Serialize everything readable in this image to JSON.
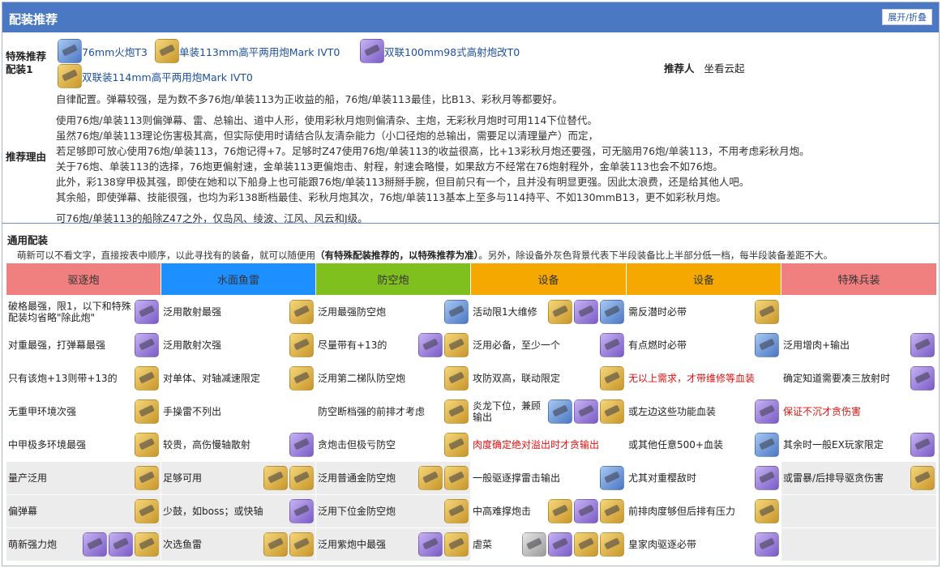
{
  "header": {
    "title": "配装推荐",
    "toggle": "展开/折叠"
  },
  "special": {
    "label": "特殊推荐配装1",
    "equipment": [
      {
        "name": "76mm火炮T3",
        "icon": "gun-icon",
        "color": "blue"
      },
      {
        "name": "单装113mm高平两用炮Mark IVT0",
        "icon": "gun-icon",
        "color": "gold"
      },
      {
        "name": "双联100mm98式高射炮改T0",
        "icon": "gun-icon",
        "color": "purple"
      },
      {
        "name": "双联装114mm高平两用炮Mark IVT0",
        "icon": "gun-icon",
        "color": "gold"
      }
    ],
    "recommender_label": "推荐人",
    "recommender": "坐看云起",
    "reason_label": "推荐理由",
    "reason_lines": [
      "自律配置。弹幕较强，是为数不多76炮/单装113为正收益的船，76炮/单装113最佳，比B13、彩秋月等都要好。",
      "使用76炮/单装113则偏弹幕、雷、总输出、道中人形，使用彩秋月炮则偏清杂、主炮，无彩秋月炮时可用114下位替代。",
      "虽然76炮/单装113理论伤害极其高，但实际使用时请结合队友清杂能力（小口径炮的总输出，需要足以清理量产）而定，",
      "若足够即可放心使用76炮/单装113，76炮记得+7。足够时Z47使用76炮/单装113的收益很高，比+13彩秋月炮还要强，可无脑用76炮/单装113，不用考虑彩秋月炮。",
      "关于76炮、单装113的选择，76炮更偏射速，金单装113更偏炮击、射程，射速会略慢，如果敌方不经常在76炮射程外，金单装113也会不如76炮。",
      "此外，彩138穿甲极其强，即使在她和以下船身上也可能跟76炮/单装113掰掰手腕，但目前只有一个，且并没有明显更强。因此太浪费，还是给其他人吧。",
      "其余船，即使弹幕、技能很强，也均为彩138断档最佳、彩秋月炮其次，76炮/单装113基本上至多与114持平、不如130mmB13，更不如彩秋月炮。",
      "可76炮/单装113的船除Z47之外，仅岛风、绫波、江风、风云和J级。"
    ]
  },
  "general": {
    "title": "通用配装",
    "note_pre": "萌新可以不看文字，直接按表中顺序，以此寻找有的装备，就可以随便用",
    "note_bold": "（有特殊配装推荐的，以特殊推荐为准）",
    "note_post": "。另外，除设备外灰色背景代表下半段装备比上半部分低一档，每半段装备差距不大。",
    "columns": [
      {
        "label": "驱逐炮",
        "color": "#f08080"
      },
      {
        "label": "水面鱼雷",
        "color": "#1e8fff"
      },
      {
        "label": "防空炮",
        "color": "#7fbf1e"
      },
      {
        "label": "设备",
        "color": "#f5a800"
      },
      {
        "label": "设备",
        "color": "#f5a800"
      },
      {
        "label": "特殊兵装",
        "color": "#f08080"
      }
    ],
    "rows": [
      [
        {
          "text": "破格最强，限1，以下和特殊配装均省略\"除此炮\"",
          "icons": [
            "purple"
          ]
        },
        {
          "text": "泛用散射最强",
          "icons": [
            "gold"
          ]
        },
        {
          "text": "泛用最强防空炮",
          "icons": [
            "blue"
          ]
        },
        {
          "text": "活动限1大维修",
          "icons": [
            "gold",
            "purple",
            "blue"
          ]
        },
        {
          "text": "需反潜时必带",
          "icons": [
            "gold"
          ]
        },
        {
          "text": "",
          "icons": []
        }
      ],
      [
        {
          "text": "对重最强，打弹幕最强",
          "icons": [
            "purple"
          ]
        },
        {
          "text": "泛用散射次强",
          "icons": [
            "gold"
          ]
        },
        {
          "text": "尽量带有+13的",
          "icons": [
            "purple",
            "gold"
          ]
        },
        {
          "text": "泛用必备，至少一个",
          "icons": [
            "purple"
          ]
        },
        {
          "text": "有点燃时必带",
          "icons": [
            "blue"
          ]
        },
        {
          "text": "泛用增肉+输出",
          "icons": [
            "purple"
          ]
        }
      ],
      [
        {
          "text": "只有该炮+13则带+13的",
          "icons": [
            "gold"
          ]
        },
        {
          "text": "对单体、对轴减速限定",
          "icons": [
            "gold"
          ]
        },
        {
          "text": "泛用第二梯队防空炮",
          "icons": [
            "gold"
          ]
        },
        {
          "text": "攻防双高，联动限定",
          "icons": [
            "gold"
          ]
        },
        {
          "text": "无以上需求，才带维修等血装",
          "icons": [],
          "red": true
        },
        {
          "text": "确定知道需要凑三放射时",
          "icons": [
            "purple"
          ]
        }
      ],
      [
        {
          "text": "无重甲环境次强",
          "icons": [
            "gold"
          ]
        },
        {
          "text": "手操雷不列出",
          "icons": []
        },
        {
          "text": "防空断档强的前排才考虑",
          "icons": [
            "gold"
          ]
        },
        {
          "text": "炎龙下位，兼顾输出",
          "icons": [
            "blue",
            "purple",
            "gold"
          ]
        },
        {
          "text": "或左边这些功能血装",
          "icons": [
            "purple"
          ]
        },
        {
          "text": "保证不沉才贪伤害",
          "icons": [],
          "red": true
        }
      ],
      [
        {
          "text": "中甲极多环境最强",
          "icons": [
            "gold"
          ]
        },
        {
          "text": "较贵，高伤慢轴散射",
          "icons": [
            "purple"
          ]
        },
        {
          "text": "贪炮击但极亏防空",
          "icons": [
            "gold"
          ]
        },
        {
          "text": "肉度确定绝对溢出时才贪输出",
          "icons": [],
          "red": true
        },
        {
          "text": "或其他任意500+血装",
          "icons": [
            "blue"
          ]
        },
        {
          "text": "其余时一般EX玩家限定",
          "icons": [
            "purple"
          ]
        }
      ],
      [
        {
          "text": "量产泛用",
          "icons": [
            "gold"
          ]
        },
        {
          "text": "足够可用",
          "icons": [
            "gold",
            "gold"
          ]
        },
        {
          "text": "泛用普通金防空炮",
          "icons": [
            "gold",
            "gold"
          ]
        },
        {
          "text": "一般驱逐撑雷击输出",
          "icons": [
            "blue"
          ]
        },
        {
          "text": "尤其对重樱敌时",
          "icons": [
            "purple"
          ]
        },
        {
          "text": "或雷暴/后排导驱贪伤害",
          "icons": [
            "gold"
          ]
        }
      ],
      [
        {
          "text": "偏弹幕",
          "icons": [
            "gold"
          ]
        },
        {
          "text": "少鼓，如boss；或快轴",
          "icons": [
            "purple"
          ]
        },
        {
          "text": "泛用下位金防空炮",
          "icons": [
            "gold"
          ]
        },
        {
          "text": "中高难撑炮击",
          "icons": [
            "gold",
            "purple",
            "gold"
          ]
        },
        {
          "text": "前排肉度够但后排有压力",
          "icons": [
            "gold"
          ]
        },
        {
          "text": "",
          "icons": []
        }
      ],
      [
        {
          "text": "萌新强力炮",
          "icons": [
            "purple",
            "purple",
            "gold"
          ]
        },
        {
          "text": "次选鱼雷",
          "icons": [
            "gold",
            "gold"
          ]
        },
        {
          "text": "泛用紫炮中最强",
          "icons": [
            "purple",
            "gold"
          ]
        },
        {
          "text": "虐菜",
          "icons": [
            "gray",
            "purple",
            "gold",
            "gold"
          ]
        },
        {
          "text": "皇家肉驱逐必带",
          "icons": [
            "purple"
          ]
        },
        {
          "text": "",
          "icons": []
        }
      ]
    ]
  }
}
